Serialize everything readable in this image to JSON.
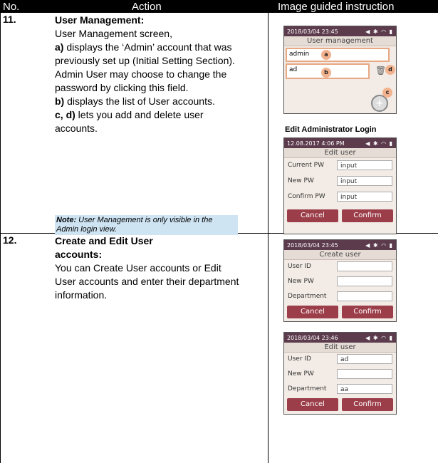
{
  "header": {
    "col_no": "No.",
    "col_action": "Action",
    "col_image": "Image guided instruction"
  },
  "row11": {
    "num": "11.",
    "title": "User Management:",
    "line1": "User Management screen,",
    "a_label": "a)",
    "a_text": " displays the ‘Admin’ account that was previously set up (Initial Setting Section). Admin User may choose to change the password by clicking this field.",
    "b_label": "b)",
    "b_text": " displays the list of User accounts.",
    "cd_label": "c, d)",
    "cd_text": " lets you add and delete user accounts.",
    "note_label": "Note:",
    "note_text": " User Management is only visible in the Admin login view.",
    "screen_um": {
      "time": "2018/03/04 23:45",
      "title": "User management",
      "rows": [
        "admin",
        "ad"
      ],
      "callouts": [
        "a",
        "b",
        "c",
        "d"
      ]
    },
    "edit_admin_title": "Edit Administrator Login",
    "screen_edit": {
      "time": "12.08.2017 4:06 PM",
      "title": "Edit user",
      "fields": [
        {
          "label": "Current PW",
          "value": "input"
        },
        {
          "label": "New PW",
          "value": "input"
        },
        {
          "label": "Confirm PW",
          "value": "input"
        }
      ],
      "cancel": "Cancel",
      "confirm": "Confirm"
    }
  },
  "row12": {
    "num": "12.",
    "title": "Create and Edit User accounts:",
    "body": "You can Create User accounts or Edit User accounts and enter their department information.",
    "screen_create": {
      "time": "2018/03/04 23:45",
      "title": "Create user",
      "fields": [
        {
          "label": "User ID",
          "value": ""
        },
        {
          "label": "New PW",
          "value": ""
        },
        {
          "label": "Department",
          "value": ""
        }
      ],
      "cancel": "Cancel",
      "confirm": "Confirm"
    },
    "screen_edit": {
      "time": "2018/03/04 23:46",
      "title": "Edit user",
      "fields": [
        {
          "label": "User ID",
          "value": "ad"
        },
        {
          "label": "New PW",
          "value": ""
        },
        {
          "label": "Department",
          "value": "aa"
        }
      ],
      "cancel": "Cancel",
      "confirm": "Confirm"
    }
  },
  "icons": {
    "status": "volume-bluetooth-wifi-battery-icons",
    "trash": "trash-icon",
    "add": "plus-circle-icon"
  },
  "colors": {
    "button": "#9b3e4a",
    "statusbar": "#5c3b4d",
    "callout": "#f2b28e",
    "note_bg": "#cfe4f3"
  }
}
